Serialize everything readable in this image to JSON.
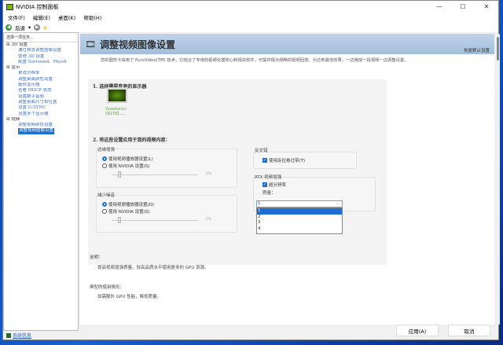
{
  "window": {
    "title": "NVIDIA 控制面板",
    "minimize": "—",
    "maximize": "☐",
    "close": "✕"
  },
  "menu": [
    "文件(F)",
    "编辑(E)",
    "桌面(K)",
    "帮助(H)"
  ],
  "toolbar": {
    "back": "后退"
  },
  "sidebar": {
    "header": "选择一项任务...",
    "tree": [
      {
        "type": "cat",
        "label": "⊟ 3D 设置"
      },
      {
        "type": "item",
        "label": "通过预览调整图像设置"
      },
      {
        "type": "item",
        "label": "管理 3D 设置"
      },
      {
        "type": "item",
        "label": "配置 Surround、PhysX"
      },
      {
        "type": "cat",
        "label": "⊟ 显示"
      },
      {
        "type": "item",
        "label": "更改分辨率"
      },
      {
        "type": "item",
        "label": "调整桌面颜色设置"
      },
      {
        "type": "item",
        "label": "旋转显示器"
      },
      {
        "type": "item",
        "label": "查看 HDCP 状态"
      },
      {
        "type": "item",
        "label": "设置数字音频"
      },
      {
        "type": "item",
        "label": "调整桌面尺寸和位置"
      },
      {
        "type": "item",
        "label": "设置 G-SYNC"
      },
      {
        "type": "item",
        "label": "设置多个显示器"
      },
      {
        "type": "cat",
        "label": "⊟ 视频"
      },
      {
        "type": "item",
        "label": "调整视频颜色设置"
      },
      {
        "type": "sel",
        "label": "调整视频图像设置"
      }
    ],
    "system_info": "系统信息"
  },
  "page": {
    "title": "调整视频图像设置",
    "restore": "恢复默认设置",
    "intro": "您的图形卡采用了 PureVideo(TM) 技术，它结合了专用的视频处理核心和相关软件，可提供极为顺畅的视频回放。为达到最佳效果，一边播放一段视频一边调整设置。",
    "step1": "1.  选择需要变更的显示器",
    "monitor": [
      "ViewSonic",
      "VX2781..."
    ],
    "step2": "2.  将这些设置应用于我的视频内容：",
    "edge": {
      "label": "边缘增强",
      "opt1": "使用视频播放器设置(L)",
      "opt2": "使用 NVIDIA 设置(S)",
      "pct": "0%"
    },
    "noise": {
      "label": "减少噪音",
      "opt1": "使用视频播放器设置(D)",
      "opt2": "使用 NVIDIA 设置(S)",
      "pct": "0%"
    },
    "deint": {
      "label": "反交错",
      "opt": "使用反拉卷过带(T)"
    },
    "rtx": {
      "label": "RTX 视频增强",
      "opt": "超分辨率",
      "quality_label": "质量：",
      "selected": "1",
      "options": [
        "1",
        "2",
        "3",
        "4"
      ]
    },
    "desc_label": "说明：",
    "desc": "提高视频增强质量。较高品质水平使用更多的 GPU 资源。",
    "usage_label": "典型的使用情形：",
    "usage": "如需额外 GPU 性能，降低质量。"
  },
  "buttons": {
    "apply": "应用(A)",
    "cancel": "取消"
  }
}
